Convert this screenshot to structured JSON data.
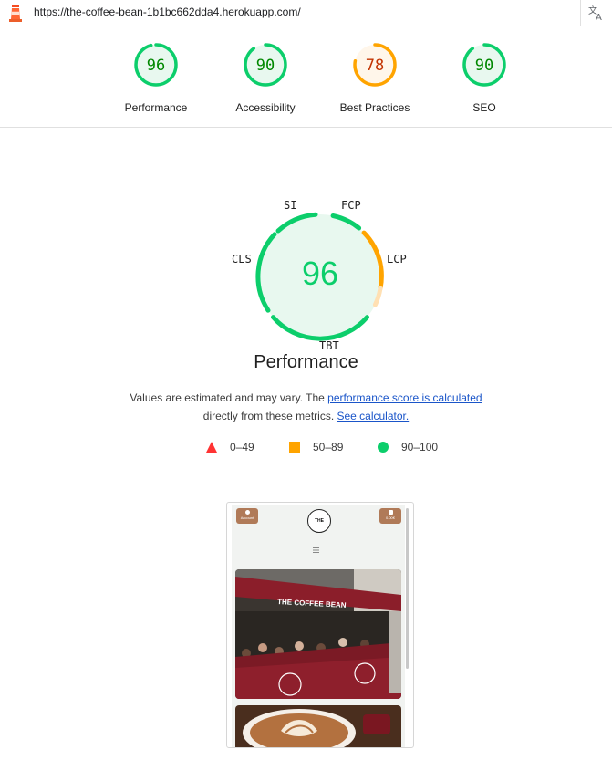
{
  "url_bar": {
    "url": "https://the-coffee-bean-1b1bc662dda4.herokuapp.com/"
  },
  "summary_scores": [
    {
      "value": "96",
      "score": 96,
      "label": "Performance",
      "color": "#0cce6b",
      "bg": "#e8f8ef",
      "text_color": "#008800"
    },
    {
      "value": "90",
      "score": 90,
      "label": "Accessibility",
      "color": "#0cce6b",
      "bg": "#e8f8ef",
      "text_color": "#008800"
    },
    {
      "value": "78",
      "score": 78,
      "label": "Best Practices",
      "color": "#ffa400",
      "bg": "#fff6ea",
      "text_color": "#c33300"
    },
    {
      "value": "90",
      "score": 90,
      "label": "SEO",
      "color": "#0cce6b",
      "bg": "#e8f8ef",
      "text_color": "#008800"
    }
  ],
  "performance_gauge": {
    "score": "96",
    "title": "Performance",
    "metrics": {
      "si": "SI",
      "fcp": "FCP",
      "lcp": "LCP",
      "tbt": "TBT",
      "cls": "CLS"
    }
  },
  "description": {
    "text_before": "Values are estimated and may vary. The ",
    "link1": "performance score is calculated",
    "text_middle": "directly from these metrics. ",
    "link2": "See calculator."
  },
  "legend": [
    {
      "range": "0–49",
      "shape": "triangle",
      "color": "#ff3333"
    },
    {
      "range": "50–89",
      "shape": "square",
      "color": "#ffa400"
    },
    {
      "range": "90–100",
      "shape": "circle",
      "color": "#0cce6b"
    }
  ],
  "screenshot_preview": {
    "account_label": "Account",
    "cart_label": "0.00€",
    "logo_text": "THE",
    "photo_sign_text": "THE COFFEE BEAN"
  }
}
